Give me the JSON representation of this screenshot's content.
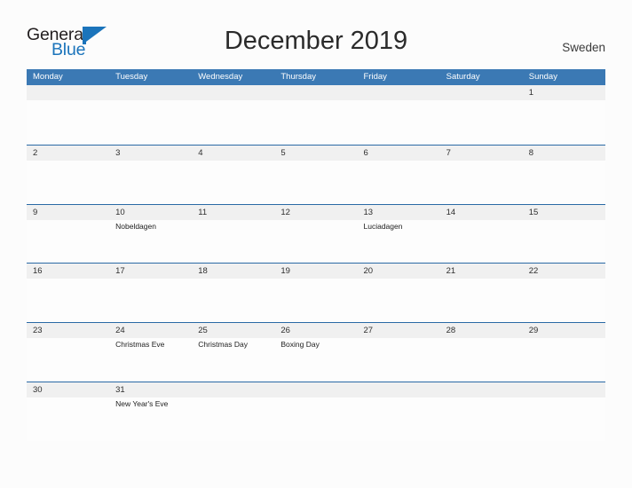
{
  "brand": {
    "name_part1": "General",
    "name_part2": "Blue",
    "flag_icon": "triangle-flag-icon",
    "color_dark": "#231f20",
    "color_blue": "#1b74bb"
  },
  "header": {
    "title": "December 2019",
    "locale": "Sweden"
  },
  "theme": {
    "header_bar_color": "#3b79b4",
    "row_border_color": "#2a6aa5",
    "daynum_band_color": "#f0f0f0",
    "page_background": "#fcfcfc"
  },
  "weekdays": [
    "Monday",
    "Tuesday",
    "Wednesday",
    "Thursday",
    "Friday",
    "Saturday",
    "Sunday"
  ],
  "weeks": [
    {
      "days": [
        {
          "num": "",
          "events": []
        },
        {
          "num": "",
          "events": []
        },
        {
          "num": "",
          "events": []
        },
        {
          "num": "",
          "events": []
        },
        {
          "num": "",
          "events": []
        },
        {
          "num": "",
          "events": []
        },
        {
          "num": "1",
          "events": []
        }
      ]
    },
    {
      "days": [
        {
          "num": "2",
          "events": []
        },
        {
          "num": "3",
          "events": []
        },
        {
          "num": "4",
          "events": []
        },
        {
          "num": "5",
          "events": []
        },
        {
          "num": "6",
          "events": []
        },
        {
          "num": "7",
          "events": []
        },
        {
          "num": "8",
          "events": []
        }
      ]
    },
    {
      "days": [
        {
          "num": "9",
          "events": []
        },
        {
          "num": "10",
          "events": [
            "Nobeldagen"
          ]
        },
        {
          "num": "11",
          "events": []
        },
        {
          "num": "12",
          "events": []
        },
        {
          "num": "13",
          "events": [
            "Luciadagen"
          ]
        },
        {
          "num": "14",
          "events": []
        },
        {
          "num": "15",
          "events": []
        }
      ]
    },
    {
      "days": [
        {
          "num": "16",
          "events": []
        },
        {
          "num": "17",
          "events": []
        },
        {
          "num": "18",
          "events": []
        },
        {
          "num": "19",
          "events": []
        },
        {
          "num": "20",
          "events": []
        },
        {
          "num": "21",
          "events": []
        },
        {
          "num": "22",
          "events": []
        }
      ]
    },
    {
      "days": [
        {
          "num": "23",
          "events": []
        },
        {
          "num": "24",
          "events": [
            "Christmas Eve"
          ]
        },
        {
          "num": "25",
          "events": [
            "Christmas Day"
          ]
        },
        {
          "num": "26",
          "events": [
            "Boxing Day"
          ]
        },
        {
          "num": "27",
          "events": []
        },
        {
          "num": "28",
          "events": []
        },
        {
          "num": "29",
          "events": []
        }
      ]
    },
    {
      "days": [
        {
          "num": "30",
          "events": []
        },
        {
          "num": "31",
          "events": [
            "New Year's Eve"
          ]
        },
        {
          "num": "",
          "events": []
        },
        {
          "num": "",
          "events": []
        },
        {
          "num": "",
          "events": []
        },
        {
          "num": "",
          "events": []
        },
        {
          "num": "",
          "events": []
        }
      ]
    }
  ]
}
